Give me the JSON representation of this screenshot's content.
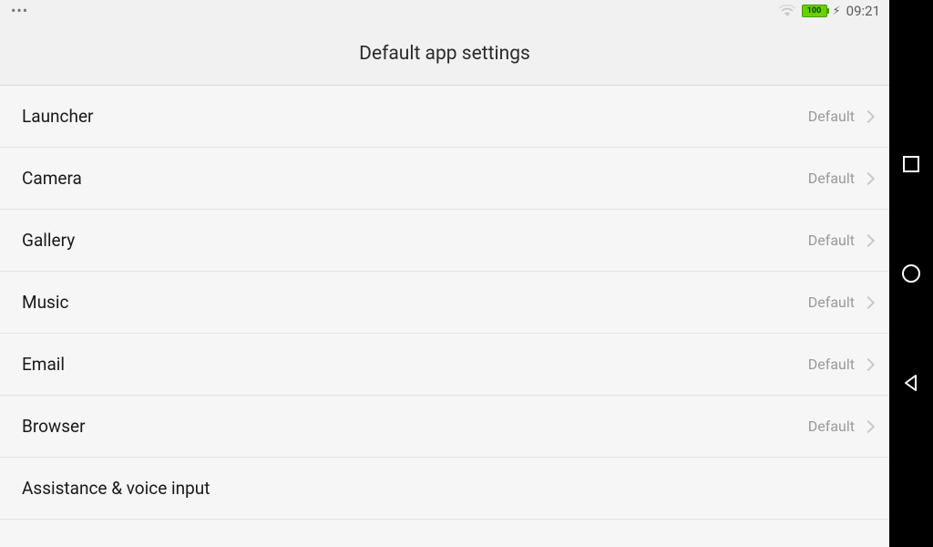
{
  "statusbar": {
    "battery_level": "100",
    "time": "09:21"
  },
  "header": {
    "title": "Default app settings"
  },
  "items": [
    {
      "label": "Launcher",
      "value": "Default",
      "has_chevron": true
    },
    {
      "label": "Camera",
      "value": "Default",
      "has_chevron": true
    },
    {
      "label": "Gallery",
      "value": "Default",
      "has_chevron": true
    },
    {
      "label": "Music",
      "value": "Default",
      "has_chevron": true
    },
    {
      "label": "Email",
      "value": "Default",
      "has_chevron": true
    },
    {
      "label": "Browser",
      "value": "Default",
      "has_chevron": true
    },
    {
      "label": "Assistance & voice input",
      "value": "",
      "has_chevron": false
    }
  ]
}
